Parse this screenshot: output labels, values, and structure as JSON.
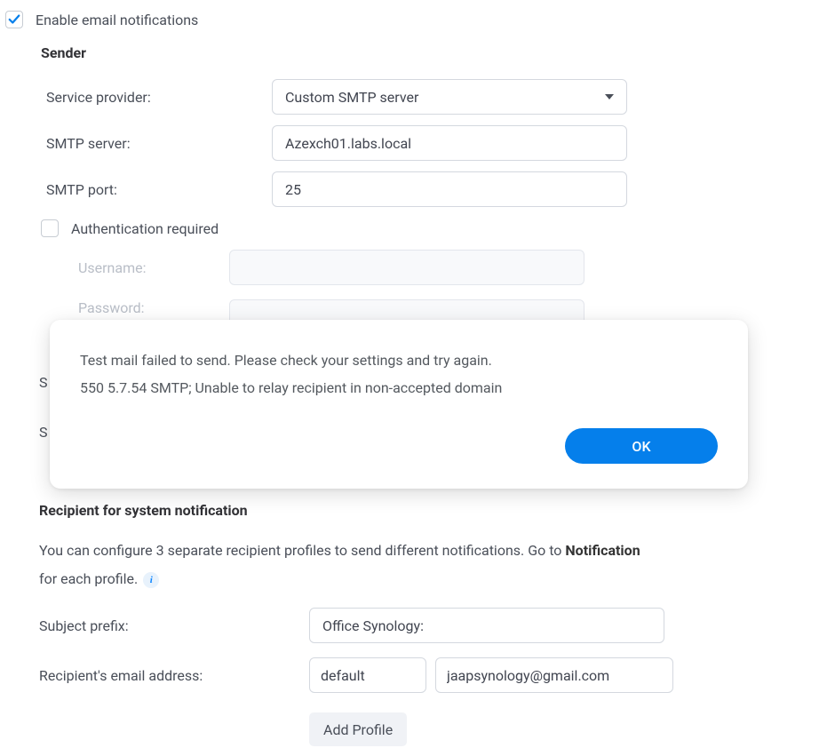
{
  "enable_notifications": {
    "label": "Enable email notifications",
    "checked": true
  },
  "sender": {
    "title": "Sender",
    "provider_label": "Service provider:",
    "provider_value": "Custom SMTP server",
    "smtp_server_label": "SMTP server:",
    "smtp_server_value": "Azexch01.labs.local",
    "smtp_port_label": "SMTP port:",
    "smtp_port_value": "25",
    "auth_required_label": "Authentication required",
    "auth_required_checked": false,
    "username_label": "Username:",
    "username_value": "",
    "password_label": "Password:",
    "password_value": ""
  },
  "partial_rows": {
    "s1": "S",
    "s2": "S"
  },
  "recipient": {
    "title": "Recipient for system notification",
    "description_part1": "You can configure 3 separate recipient profiles to send different notifications. Go to ",
    "description_bold": "Notification",
    "description_part2": "for each profile.",
    "subject_prefix_label": "Subject prefix:",
    "subject_prefix_value": "Office Synology:",
    "recipient_email_label": "Recipient's email address:",
    "profile_name_value": "default",
    "recipient_email_value": "jaapsynology@gmail.com",
    "add_profile_label": "Add Profile"
  },
  "dialog": {
    "line1": "Test mail failed to send. Please check your settings and try again.",
    "line2": "550 5.7.54 SMTP; Unable to relay recipient in non-accepted domain",
    "ok_label": "OK"
  }
}
